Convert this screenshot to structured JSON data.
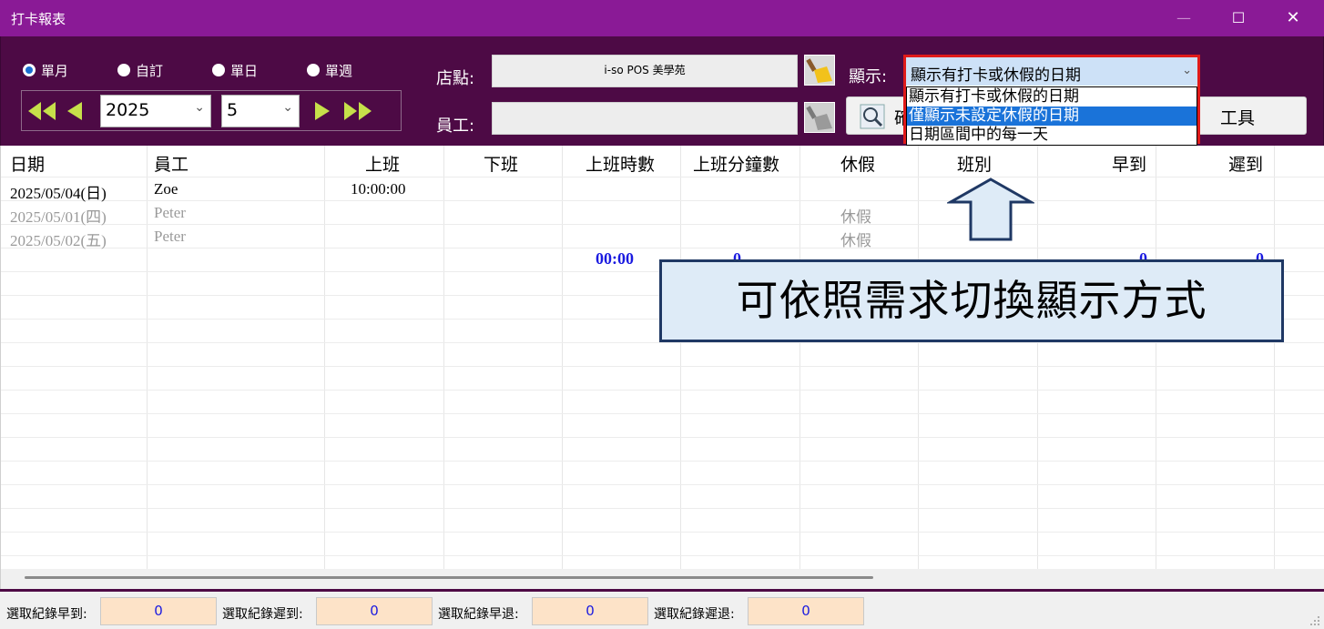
{
  "window": {
    "title": "打卡報表",
    "minimize_glyph": "—",
    "maximize_glyph": "☐",
    "close_glyph": "✕"
  },
  "mode_radios": [
    {
      "label": "單月",
      "selected": true
    },
    {
      "label": "自訂",
      "selected": false
    },
    {
      "label": "單日",
      "selected": false
    },
    {
      "label": "單週",
      "selected": false
    }
  ],
  "nav": {
    "year_value": "2025",
    "month_value": "5",
    "caret": "⌄"
  },
  "store": {
    "label": "店點:",
    "value": "i-so POS 美學苑"
  },
  "employee": {
    "label": "員工:",
    "value": ""
  },
  "display": {
    "label": "顯示:",
    "value": "顯示有打卡或休假的日期",
    "options": [
      {
        "label": "顯示有打卡或休假的日期",
        "highlighted": false
      },
      {
        "label": "僅顯示未設定休假的日期",
        "highlighted": true
      },
      {
        "label": "日期區間中的每一天",
        "highlighted": false
      }
    ]
  },
  "buttons": {
    "query_label": "確",
    "tools_label": "工具"
  },
  "table": {
    "headers": [
      "日期",
      "員工",
      "上班",
      "下班",
      "上班時數",
      "上班分鐘數",
      "休假",
      "班別",
      "早到",
      "遲到"
    ],
    "rows": [
      {
        "date": "2025/05/04(日)",
        "employee": "Zoe",
        "clock_in": "10:00:00",
        "leave": "",
        "gray": false
      },
      {
        "date": "2025/05/01(四)",
        "employee": "Peter",
        "clock_in": "",
        "leave": "休假",
        "gray": true
      },
      {
        "date": "2025/05/02(五)",
        "employee": "Peter",
        "clock_in": "",
        "leave": "休假",
        "gray": true
      }
    ],
    "totals": {
      "hours": "00:00",
      "minutes": "0",
      "early": "0",
      "late": "0"
    }
  },
  "callout": {
    "text": "可依照需求切換顯示方式"
  },
  "status_bar": [
    {
      "label": "選取紀錄早到:",
      "value": "0"
    },
    {
      "label": "選取紀錄遲到:",
      "value": "0"
    },
    {
      "label": "選取紀錄早退:",
      "value": "0"
    },
    {
      "label": "選取紀錄遲退:",
      "value": "0"
    }
  ],
  "colors": {
    "titlebar": "#8a1a96",
    "toolbar": "#4d0a45",
    "highlight": "#1a73d9",
    "callout_border": "#1f3864",
    "callout_fill": "#deebf7",
    "totals_text": "#1a1ae0"
  }
}
